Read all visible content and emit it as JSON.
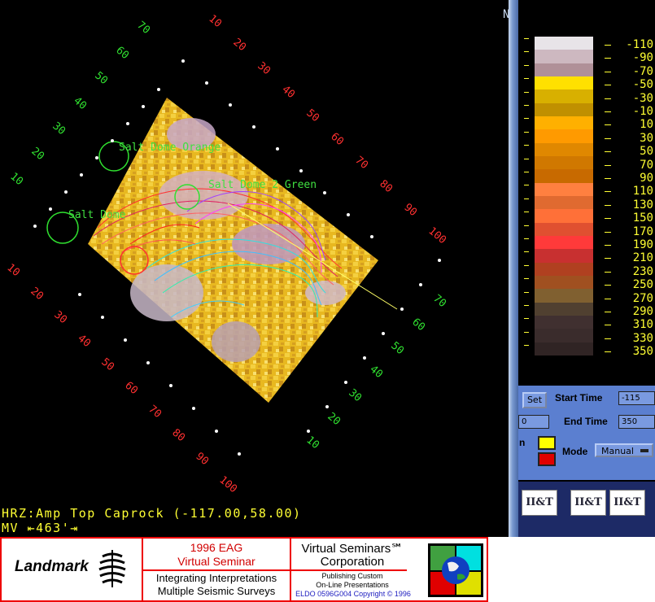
{
  "map": {
    "ring_outer_black": [
      "10",
      "20",
      "30",
      "40",
      "50",
      "60",
      "70",
      "80",
      "90",
      "100"
    ],
    "ring_labels_top_green": [
      "70",
      "60",
      "50",
      "40",
      "30",
      "20",
      "10"
    ],
    "ring_labels_top_red": [
      "10",
      "20",
      "30",
      "40",
      "50",
      "60",
      "70",
      "80",
      "90",
      "100"
    ],
    "ring_labels_right_green": [
      "70",
      "60",
      "50",
      "40",
      "30",
      "20",
      "10"
    ],
    "ring_labels_bottom_red": [
      "10",
      "20",
      "30",
      "40",
      "50",
      "60",
      "70",
      "80",
      "90",
      "100"
    ],
    "annotations": [
      {
        "text": "Salt Dome Orange"
      },
      {
        "text": "Salt Dome 2 Green"
      },
      {
        "text": "Salt Dome"
      }
    ],
    "horizon_line": "HRZ:Amp Top Caprock (-117.00,58.00)",
    "scale_bar": "MV ⇤463'⇥"
  },
  "colorscale": {
    "labels": [
      "-110",
      "-90",
      "-70",
      "-50",
      "-30",
      "-10",
      "10",
      "30",
      "50",
      "70",
      "90",
      "110",
      "130",
      "150",
      "170",
      "190",
      "210",
      "230",
      "250",
      "270",
      "290",
      "310",
      "330",
      "350"
    ],
    "colors": [
      "#e8e4e8",
      "#cdb8c0",
      "#b09098",
      "#ffe000",
      "#d8b000",
      "#c09000",
      "#ffb000",
      "#ff9a00",
      "#e08800",
      "#d07800",
      "#c86a00",
      "#ff8040",
      "#e06a30",
      "#ff7038",
      "#e05030",
      "#ff3a3a",
      "#c83030",
      "#b04020",
      "#a05020",
      "#806030",
      "#504030",
      "#403030",
      "#3a2c2c",
      "#302424"
    ]
  },
  "controls": {
    "set_label": "Set",
    "start_time_label": "Start Time",
    "start_time_value": "-115",
    "end_time_label": "End Time",
    "end_time_value": "350",
    "left_field_value": "0",
    "mode_label": "Mode",
    "mode_value": "Manual",
    "partial_label": "n"
  },
  "thumbnails": [
    "II&T",
    "II&T",
    "II&T"
  ],
  "banner": {
    "logo_text": "Landmark",
    "eag_line1": "1996 EAG",
    "eag_line2": "Virtual Seminar",
    "topic_line1": "Integrating Interpretations",
    "topic_line2": "Multiple Seismic Surveys",
    "vs_line1": "Virtual Seminars℠",
    "vs_line2": "Corporation",
    "publish_line1": "Publishing Custom",
    "publish_line2": "On-Line Presentations",
    "copyright": "ELDO 0596G004 Copyright © 1996"
  }
}
